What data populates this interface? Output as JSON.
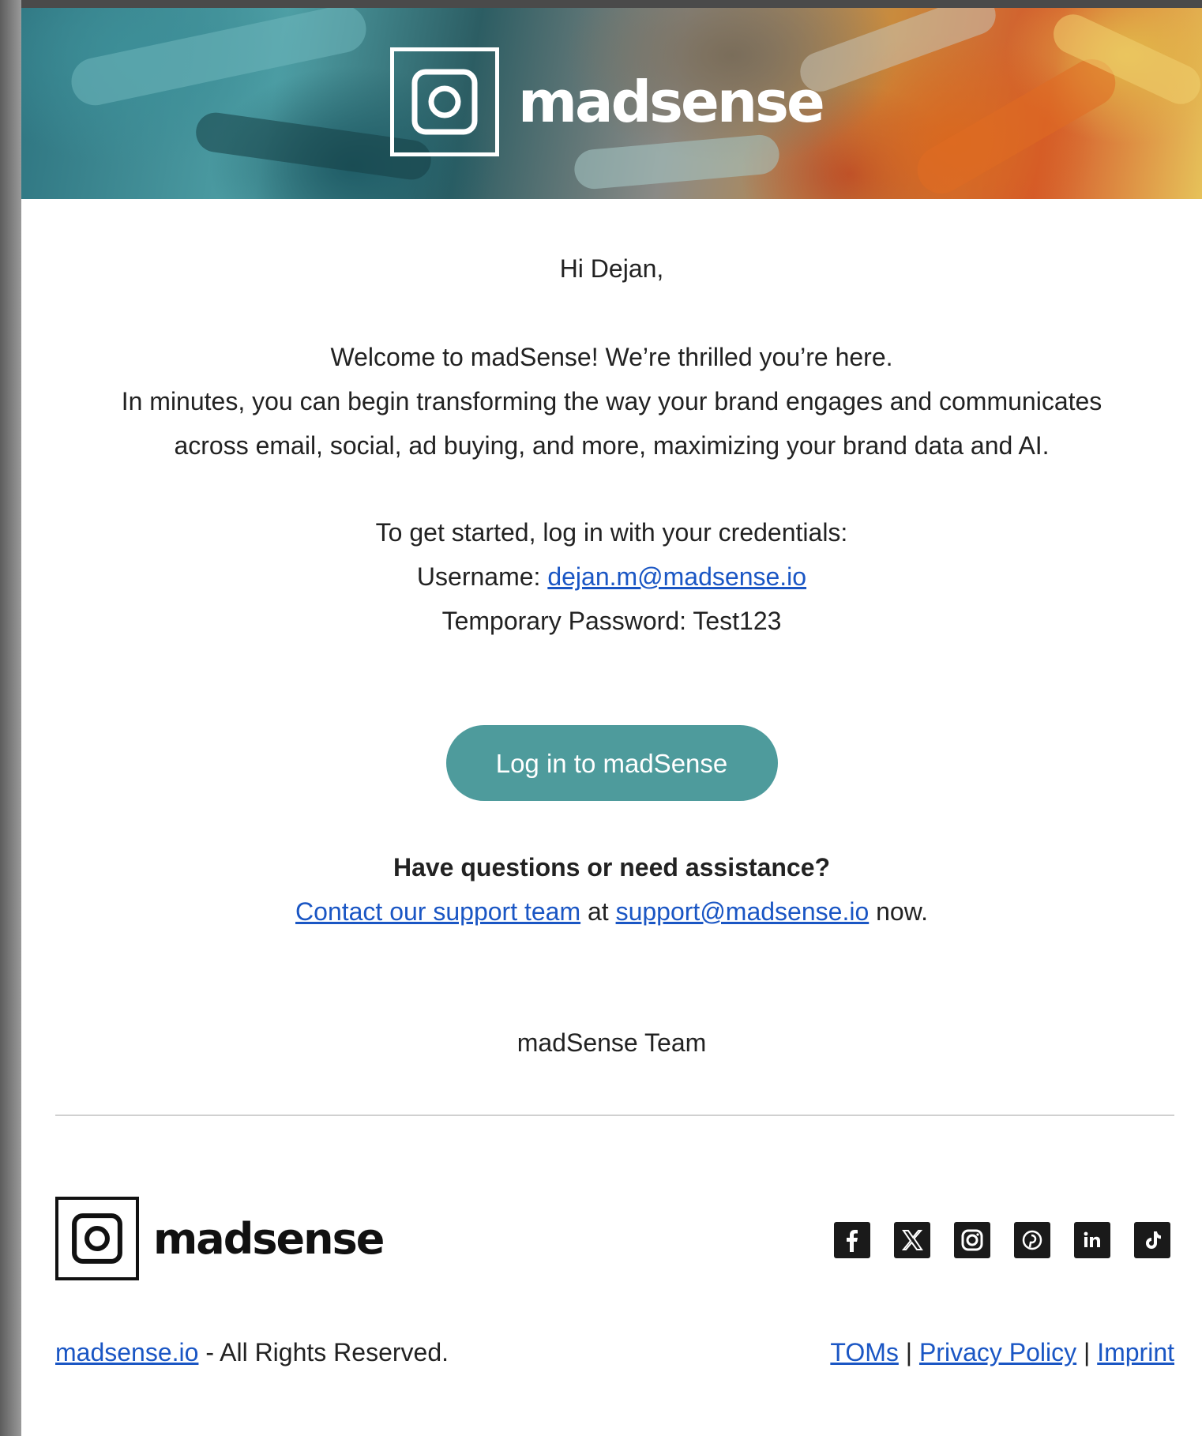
{
  "brand": {
    "wordmark": "madsense"
  },
  "email": {
    "greeting": "Hi Dejan,",
    "welcome_lines": [
      "Welcome to madSense! We’re thrilled you’re here.",
      "In minutes, you can begin transforming the way your brand engages and communicates",
      "across email, social, ad buying, and more, maximizing your brand data and AI."
    ],
    "credentials_intro": "To get started, log in with your credentials:",
    "username_label": "Username: ",
    "username_value": "dejan.m@madsense.io",
    "password_label": "Temporary Password: ",
    "password_value": "Test123",
    "cta_label": "Log in to madSense",
    "help_question": "Have questions or need assistance?",
    "help_contact_link": "Contact our support team",
    "help_at": " at ",
    "help_email": "support@madsense.io",
    "help_now": " now.",
    "signoff": "madSense Team"
  },
  "footer": {
    "site_link": "madsense.io",
    "rights": " - All Rights Reserved.",
    "links": {
      "toms": "TOMs",
      "sep1": " | ",
      "privacy": "Privacy Policy",
      "sep2": " | ",
      "imprint": "Imprint"
    },
    "social_icons": [
      "facebook-icon",
      "x-icon",
      "instagram-icon",
      "pinterest-icon",
      "linkedin-icon",
      "tiktok-icon"
    ]
  },
  "colors": {
    "cta_background": "#4e9b9c",
    "link": "#1a56c4",
    "text": "#222222"
  }
}
